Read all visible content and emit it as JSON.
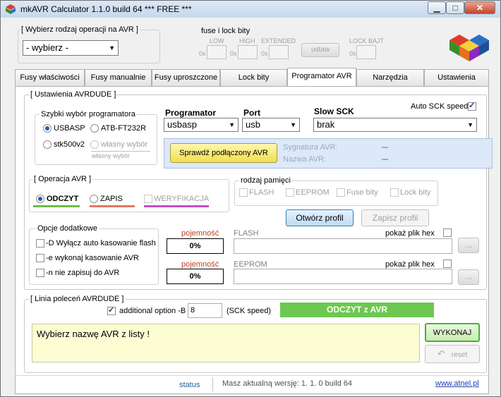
{
  "window": {
    "title": "mkAVR Calculator 1.1.0 build 64   *** FREE ***",
    "controls": {
      "minimize": "▁",
      "maximize": "□",
      "close": "✕"
    }
  },
  "top": {
    "operation_group_label": "[ Wybierz rodzaj operacji na AVR ]",
    "operation_combo_value": "- wybierz -",
    "fuse_group_label": "fuse i lock bity",
    "low_label": "LOW",
    "high_label": "HIGH",
    "extended_label": "EXTENDED",
    "lock_label": "LOCK BAJT",
    "hex_prefix": "0x",
    "set_button": "ustaw"
  },
  "tabs": [
    "Fusy właściwości",
    "Fusy manualnie",
    "Fusy uproszczone",
    "Lock bity",
    "Programator AVR",
    "Narzędzia",
    "Ustawienia"
  ],
  "active_tab_index": 4,
  "avrdude": {
    "group_label": "[ Ustawienia AVRDUDE ]",
    "quick_select_label": "Szybki wybór programatora",
    "radio_usbasp": "USBASP",
    "radio_ft232": "ATB-FT232R",
    "radio_stk": "stk500v2",
    "radio_own": "własny wybór",
    "own_hint": "własny wybór",
    "programmer_label": "Programator",
    "programmer_value": "usbasp",
    "port_label": "Port",
    "port_value": "usb",
    "slow_sck_label": "Slow SCK",
    "slow_sck_value": "brak",
    "auto_sck_label": "Auto SCK speed",
    "check_button": "Sprawdź podłączony AVR",
    "signature_label": "Sygnatura AVR:",
    "signature_value": "...",
    "name_label": "Nazwa AVR:",
    "name_value": "..."
  },
  "operation": {
    "group_label": "[ Operacja AVR ]",
    "read": "ODCZYT",
    "write": "ZAPIS",
    "verify": "WERYFIKACJA",
    "colors": {
      "read": "#6bbf45",
      "write": "#e07a5a",
      "verify": "#c44fc4"
    }
  },
  "memory": {
    "group_label": "rodzaj pamięci",
    "flash": "FLASH",
    "eeprom": "EEPROM",
    "fuse": "Fuse bity",
    "lock": "Lock bity",
    "open_profile": "Otwórz profil",
    "save_profile": "Zapisz profil"
  },
  "options": {
    "group_label": "Opcje dodatkowe",
    "opt_d": "-D Wyłącz auto kasowanie flash",
    "opt_e": "-e wykonaj kasowanie AVR",
    "opt_n": "-n nie zapisuj do AVR"
  },
  "files": {
    "capacity_label": "pojemność",
    "flash_capacity": "0%",
    "eeprom_capacity": "0%",
    "flash_label": "FLASH",
    "eeprom_label": "EEPROM",
    "show_hex": "pokaż plik hex",
    "browse": "..."
  },
  "cmdline": {
    "group_label": "[ Linia poleceń AVRDUDE ]",
    "additional_label": "additional option -B",
    "additional_value": "8",
    "sck_speed": "(SCK speed)",
    "mode_banner": "ODCZYT z AVR",
    "message": "Wybierz nazwę AVR z listy !",
    "execute": "WYKONAJ",
    "reset": "reset"
  },
  "statusbar": {
    "status": "status",
    "version": "Masz aktualną wersję: 1. 1. 0 build 64",
    "link": "www.atnel.pl"
  }
}
